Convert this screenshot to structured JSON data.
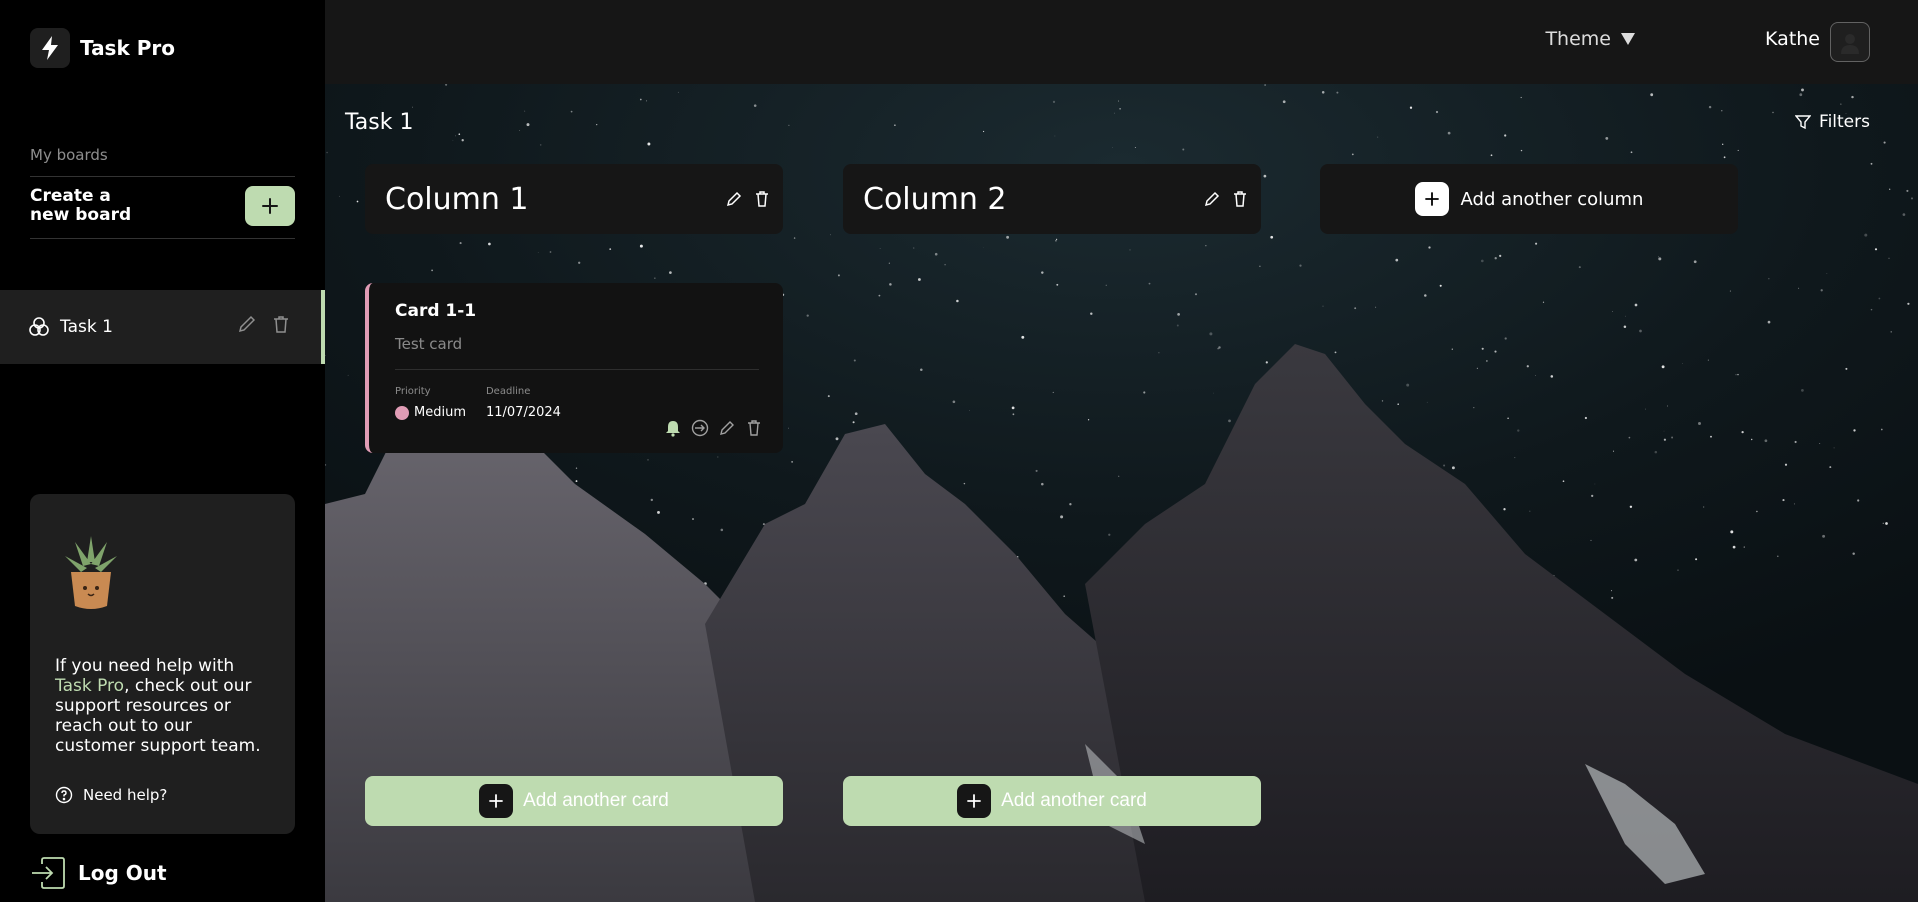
{
  "app": {
    "name": "Task Pro"
  },
  "sidebar": {
    "boards_label": "My boards",
    "create_board_label": "Create a\nnew board",
    "boards": [
      {
        "label": "Task 1",
        "icon": "puzzle-icon",
        "active": true
      }
    ],
    "help": {
      "text_before": "If you need help with ",
      "accent": "Task Pro",
      "text_after": ", check out our support resources or reach out to our customer support team.",
      "need_help_label": "Need help?"
    },
    "logout_label": "Log Out"
  },
  "header": {
    "theme_label": "Theme",
    "user_name": "Kathe"
  },
  "board": {
    "title": "Task 1",
    "filters_label": "Filters",
    "columns": [
      {
        "title": "Column 1",
        "add_card_label": "Add another card",
        "cards": [
          {
            "title": "Card 1-1",
            "description": "Test card",
            "priority_label": "Priority",
            "priority": "Medium",
            "deadline_label": "Deadline",
            "deadline": "11/07/2024"
          }
        ]
      },
      {
        "title": "Column 2",
        "add_card_label": "Add another card",
        "cards": []
      }
    ],
    "add_column_label": "Add another column"
  },
  "colors": {
    "accent": "#bedbb0",
    "priority_medium": "#e09cb5",
    "sidebar_bg": "#000000",
    "header_bg": "#161616"
  }
}
